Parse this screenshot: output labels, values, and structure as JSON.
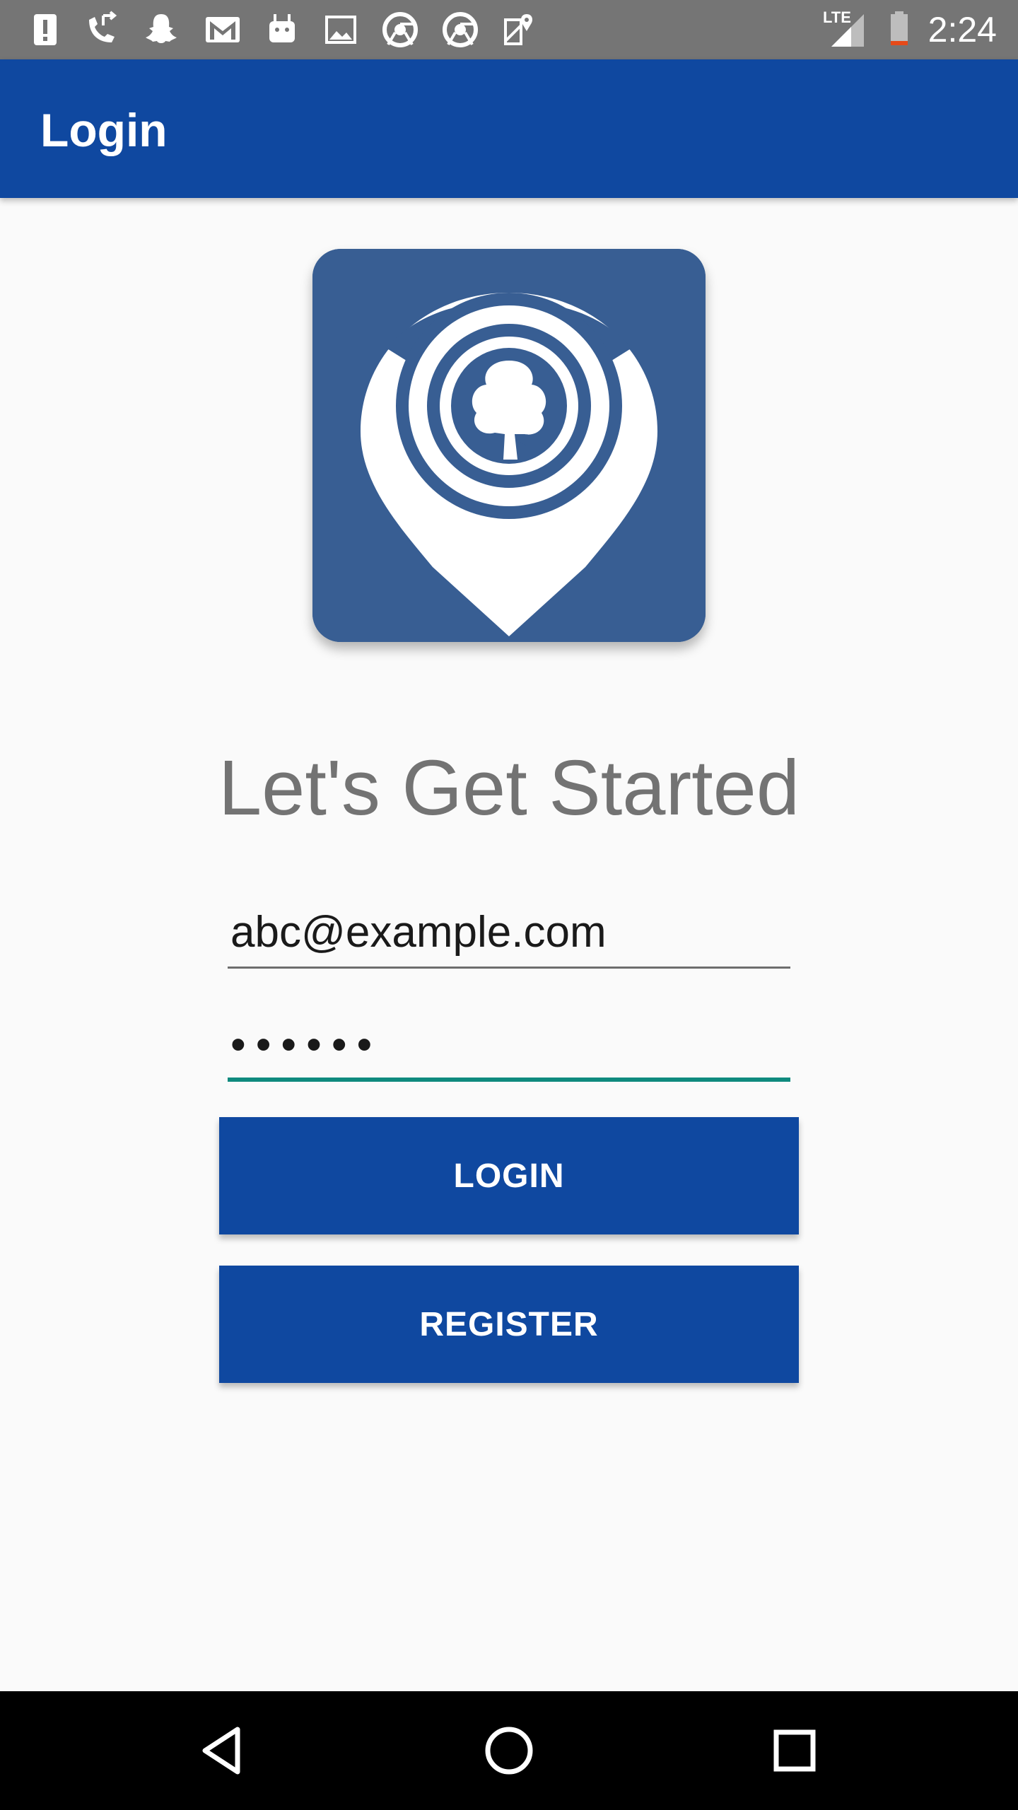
{
  "status_bar": {
    "network_label": "LTE",
    "time": "2:24",
    "icons": [
      "alert-icon",
      "call-forward-icon",
      "snapchat-icon",
      "gmail-icon",
      "android-icon",
      "image-icon",
      "chrome-icon",
      "chrome-icon",
      "maps-icon",
      "signal-icon",
      "battery-icon"
    ]
  },
  "app_bar": {
    "title": "Login"
  },
  "logo": {
    "icon": "tree-location-pin-logo",
    "background_color": "#385e93"
  },
  "main": {
    "heading": "Let's Get Started",
    "email_value": "abc@example.com",
    "password_value": "••••••",
    "login_label": "LOGIN",
    "register_label": "REGISTER"
  },
  "nav_bar": {
    "icons": [
      "back-icon",
      "home-icon",
      "recents-icon"
    ]
  },
  "colors": {
    "primary": "#0f48a0",
    "accent": "#0f8a7e",
    "status_bar": "#757575",
    "background": "#fafafa"
  }
}
